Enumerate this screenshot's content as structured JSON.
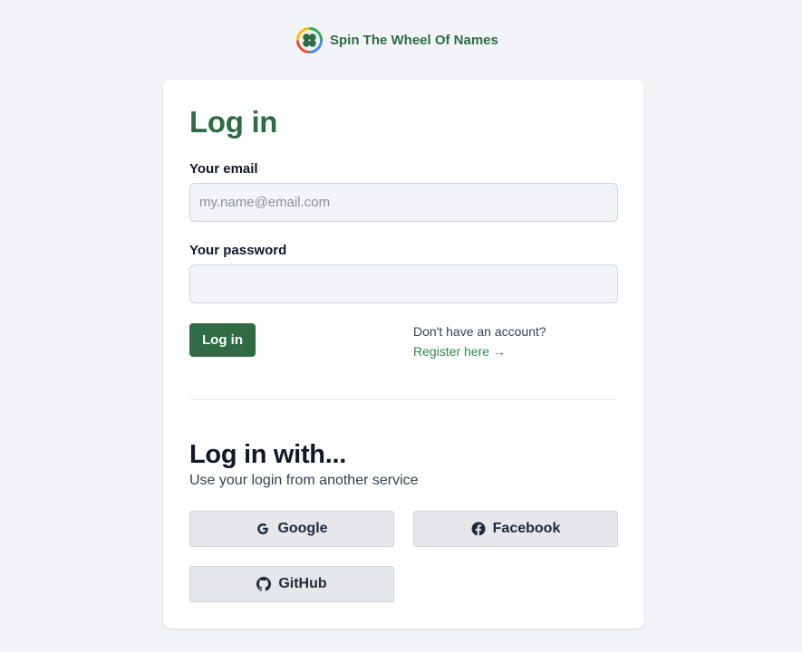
{
  "brand": {
    "name": "Spin The Wheel Of Names",
    "colors": {
      "primary": "#2f6b45",
      "link": "#2f8a4a"
    },
    "logo_icon": "clover-wheel-icon"
  },
  "login": {
    "title": "Log in",
    "email": {
      "label": "Your email",
      "placeholder": "my.name@email.com",
      "value": ""
    },
    "password": {
      "label": "Your password",
      "value": ""
    },
    "submit_label": "Log in",
    "no_account_text": "Don't have an account?",
    "register_link": "Register here →"
  },
  "social": {
    "title": "Log in with...",
    "subtitle": "Use your login from another service",
    "providers": [
      {
        "label": "Google",
        "icon": "google-icon"
      },
      {
        "label": "Facebook",
        "icon": "facebook-icon"
      },
      {
        "label": "GitHub",
        "icon": "github-icon"
      }
    ]
  }
}
